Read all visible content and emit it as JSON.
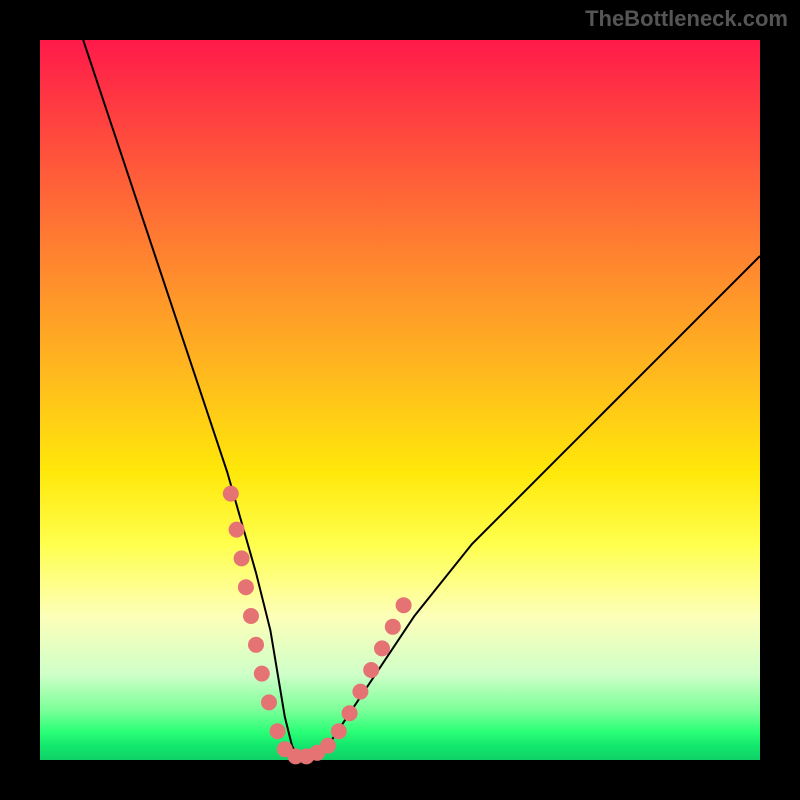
{
  "watermark": "TheBottleneck.com",
  "colors": {
    "background": "#000000",
    "gradient_top": "#ff1a4a",
    "gradient_mid": "#ffe80a",
    "gradient_bottom": "#13e86e",
    "curve": "#000000",
    "markers": "#e57373"
  },
  "chart_data": {
    "type": "line",
    "title": "",
    "xlabel": "",
    "ylabel": "",
    "xlim": [
      0,
      100
    ],
    "ylim": [
      0,
      100
    ],
    "grid": false,
    "legend": false,
    "series": [
      {
        "name": "bottleneck-curve",
        "x": [
          6,
          8,
          10,
          12,
          14,
          16,
          18,
          20,
          22,
          24,
          26,
          28,
          30,
          32,
          33,
          34,
          35,
          36,
          38,
          40,
          44,
          48,
          52,
          56,
          60,
          64,
          68,
          72,
          76,
          80,
          84,
          88,
          92,
          96,
          100
        ],
        "y": [
          100,
          94,
          88,
          82,
          76,
          70,
          64,
          58,
          52,
          46,
          40,
          33,
          26,
          18,
          12,
          6,
          2,
          0,
          0,
          2,
          8,
          14,
          20,
          25,
          30,
          34,
          38,
          42,
          46,
          50,
          54,
          58,
          62,
          66,
          70
        ]
      }
    ],
    "markers": {
      "name": "highlight-dots",
      "points": [
        {
          "x": 26.5,
          "y": 37
        },
        {
          "x": 27.3,
          "y": 32
        },
        {
          "x": 28.0,
          "y": 28
        },
        {
          "x": 28.6,
          "y": 24
        },
        {
          "x": 29.3,
          "y": 20
        },
        {
          "x": 30.0,
          "y": 16
        },
        {
          "x": 30.8,
          "y": 12
        },
        {
          "x": 31.8,
          "y": 8
        },
        {
          "x": 33.0,
          "y": 4
        },
        {
          "x": 34.0,
          "y": 1.5
        },
        {
          "x": 35.5,
          "y": 0.5
        },
        {
          "x": 37.0,
          "y": 0.5
        },
        {
          "x": 38.5,
          "y": 1.0
        },
        {
          "x": 40.0,
          "y": 2.0
        },
        {
          "x": 41.5,
          "y": 4.0
        },
        {
          "x": 43.0,
          "y": 6.5
        },
        {
          "x": 44.5,
          "y": 9.5
        },
        {
          "x": 46.0,
          "y": 12.5
        },
        {
          "x": 47.5,
          "y": 15.5
        },
        {
          "x": 49.0,
          "y": 18.5
        },
        {
          "x": 50.5,
          "y": 21.5
        }
      ]
    }
  }
}
